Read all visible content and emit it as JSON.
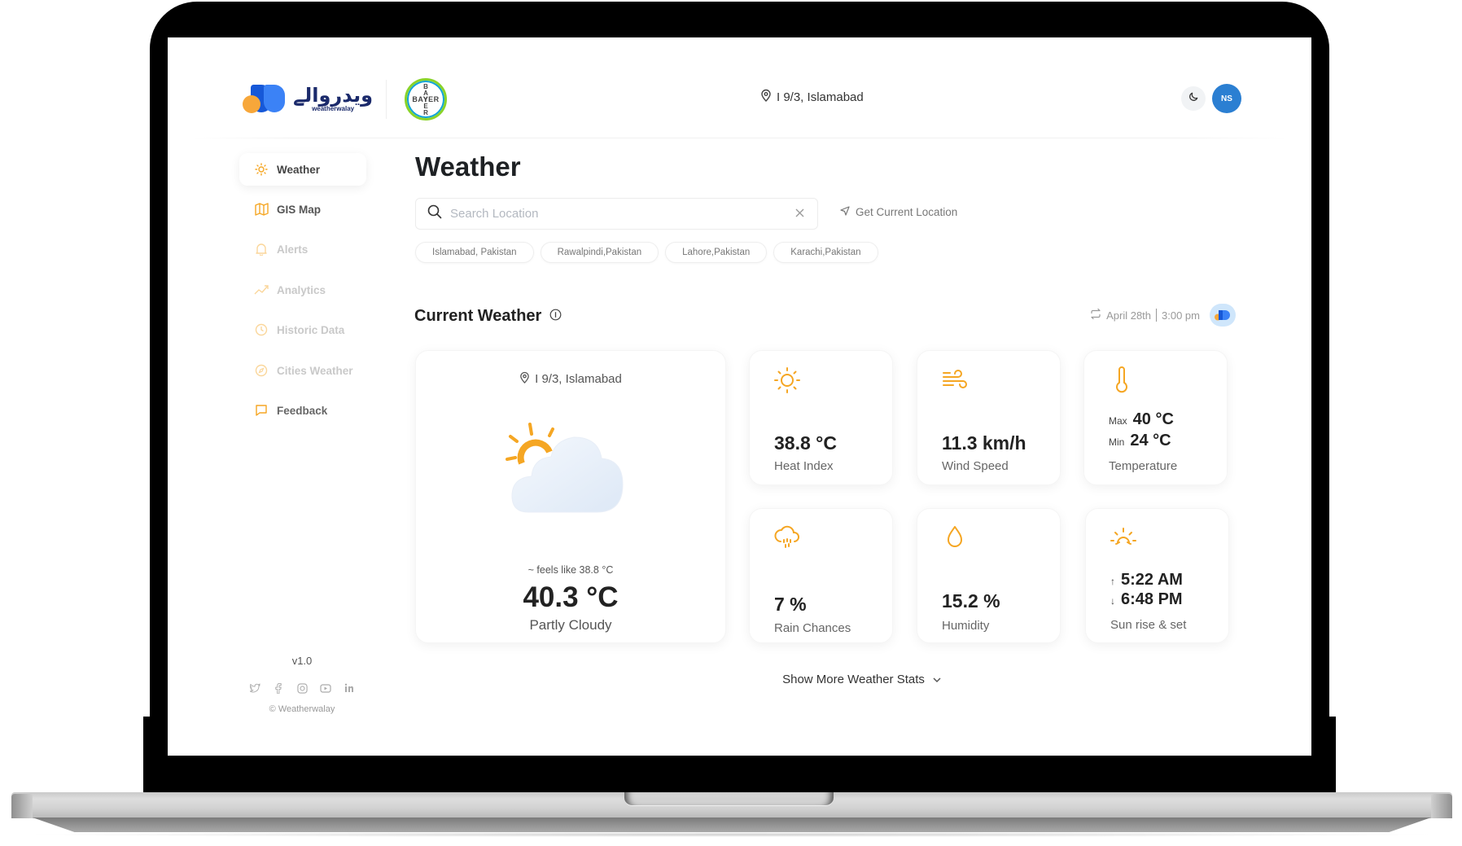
{
  "brand": {
    "logo_urdu": "ویدروالے",
    "logo_english": "weatherwalay",
    "partner_vertical": "BAYER",
    "partner_horizontal": "BAYER"
  },
  "header": {
    "location": "I 9/3, Islamabad",
    "theme_icon": "moon-icon",
    "user_initials": "NS"
  },
  "sidebar": {
    "items": [
      {
        "label": "Weather",
        "icon": "sun-icon",
        "active": true
      },
      {
        "label": "GIS Map",
        "icon": "map-icon",
        "active": false
      },
      {
        "label": "Alerts",
        "icon": "bell-icon",
        "active": false
      },
      {
        "label": "Analytics",
        "icon": "trend-icon",
        "active": false
      },
      {
        "label": "Historic Data",
        "icon": "clock-icon",
        "active": false
      },
      {
        "label": "Cities Weather",
        "icon": "compass-icon",
        "active": false
      },
      {
        "label": "Feedback",
        "icon": "message-icon",
        "active": false
      }
    ],
    "version": "v1.0",
    "socials": [
      "twitter-icon",
      "facebook-icon",
      "instagram-icon",
      "youtube-icon",
      "linkedin-icon"
    ],
    "copyright": "© Weatherwalay"
  },
  "main": {
    "title": "Weather",
    "search": {
      "placeholder": "Search Location",
      "value": ""
    },
    "get_location_label": "Get Current Location",
    "suggestions": [
      "Islamabad, Pakistan",
      "Rawalpindi,Pakistan",
      "Lahore,Pakistan",
      "Karachi,Pakistan"
    ],
    "current_weather": {
      "title": "Current Weather",
      "date": "April 28th",
      "time": "3:00 pm",
      "location": "I 9/3, Islamabad",
      "feels_like": "~ feels like 38.8 °C",
      "temperature": "40.3 °C",
      "condition": "Partly Cloudy"
    },
    "stats": {
      "heat_index": {
        "value": "38.8 °C",
        "label": "Heat Index"
      },
      "wind_speed": {
        "value": "11.3 km/h",
        "label": "Wind Speed"
      },
      "temperature": {
        "max_label": "Max",
        "max": "40 °C",
        "min_label": "Min",
        "min": "24 °C",
        "label": "Temperature"
      },
      "rain": {
        "value": "7 %",
        "label": "Rain Chances"
      },
      "humidity": {
        "value": "15.2 %",
        "label": "Humidity"
      },
      "sun": {
        "sunrise": "5:22 AM",
        "sunset": "6:48 PM",
        "label": "Sun rise & set"
      }
    },
    "show_more_label": "Show More Weather Stats"
  },
  "colors": {
    "accent": "#f5a623",
    "avatar": "#2b7fd2",
    "brand_blue": "#1658d8",
    "brand_orange": "#f7a73a"
  }
}
